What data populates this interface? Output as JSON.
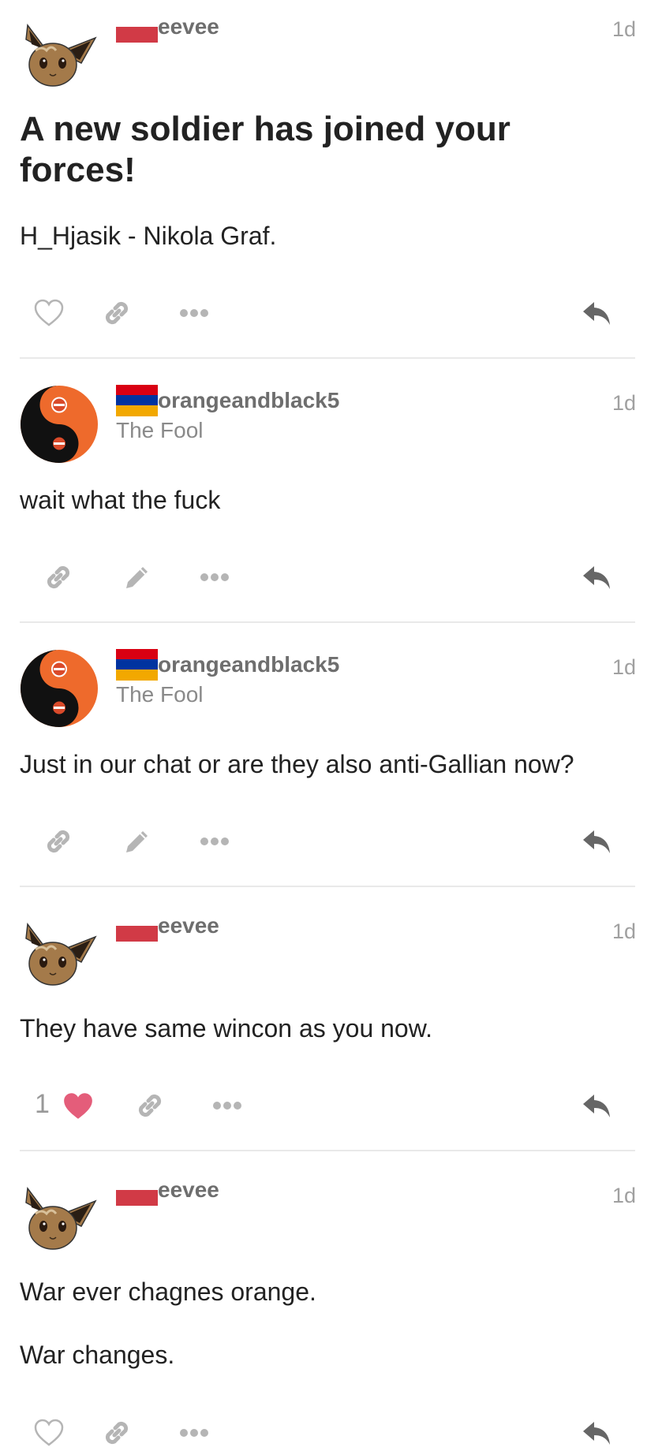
{
  "posts": [
    {
      "username": "eevee",
      "user_title": "",
      "age": "1d",
      "title": "A new soldier has joined your forces!",
      "body": [
        "H_Hjasik - Nikola Graf."
      ],
      "likes": "",
      "liked": false,
      "actions": [
        "like-icon",
        "link-icon",
        "more-icon",
        "reply-icon"
      ]
    },
    {
      "username": "orangeandblack5",
      "user_title": "The Fool",
      "age": "1d",
      "title": "",
      "body": [
        "wait what the fuck"
      ],
      "likes": "",
      "liked": false,
      "actions": [
        "link-icon",
        "edit-icon",
        "more-icon",
        "reply-icon"
      ]
    },
    {
      "username": "orangeandblack5",
      "user_title": "The Fool",
      "age": "1d",
      "title": "",
      "body": [
        "Just in our chat or are they also anti-Gallian now?"
      ],
      "likes": "",
      "liked": false,
      "actions": [
        "link-icon",
        "edit-icon",
        "more-icon",
        "reply-icon"
      ]
    },
    {
      "username": "eevee",
      "user_title": "",
      "age": "1d",
      "title": "",
      "body": [
        "They have same wincon as you now."
      ],
      "likes": "1",
      "liked": true,
      "actions": [
        "like-icon",
        "link-icon",
        "more-icon",
        "reply-icon"
      ]
    },
    {
      "username": "eevee",
      "user_title": "",
      "age": "1d",
      "title": "",
      "body": [
        "War ever chagnes orange.",
        "War changes."
      ],
      "likes": "",
      "liked": false,
      "actions": [
        "like-icon",
        "link-icon",
        "more-icon",
        "reply-icon"
      ]
    }
  ],
  "colors": {
    "flag_red": "#d13a46",
    "flag_armenia": [
      "#d90012",
      "#0033a0",
      "#f2a800"
    ],
    "heart_liked": "#e45d7a",
    "icon_gray": "#b5b5b5",
    "reply_gray": "#666666"
  }
}
